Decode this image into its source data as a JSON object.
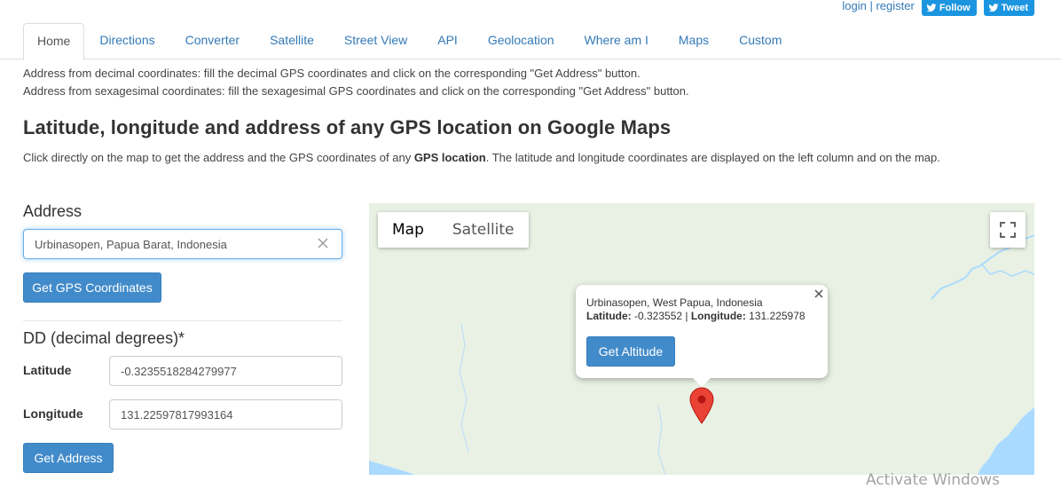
{
  "topbar": {
    "login": "login",
    "separator": "|",
    "register": "register",
    "follow": "Follow",
    "tweet": "Tweet"
  },
  "tabs": [
    {
      "label": "Home",
      "active": true
    },
    {
      "label": "Directions"
    },
    {
      "label": "Converter"
    },
    {
      "label": "Satellite"
    },
    {
      "label": "Street View"
    },
    {
      "label": "API"
    },
    {
      "label": "Geolocation"
    },
    {
      "label": "Where am I"
    },
    {
      "label": "Maps"
    },
    {
      "label": "Custom"
    }
  ],
  "intro": {
    "line1": "Address from decimal coordinates: fill the decimal GPS coordinates and click on the corresponding \"Get Address\" button.",
    "line2": "Address from sexagesimal coordinates: fill the sexagesimal GPS coordinates and click on the corresponding \"Get Address\" button."
  },
  "page": {
    "title": "Latitude, longitude and address of any GPS location on Google Maps",
    "desc_before": "Click directly on the map to get the address and the GPS coordinates of any ",
    "desc_bold": "GPS location",
    "desc_after": ". The latitude and longitude coordinates are displayed on the left column and on the map."
  },
  "address": {
    "heading": "Address",
    "value": "Urbinasopen, Papua Barat, Indonesia",
    "button": "Get GPS Coordinates"
  },
  "dd": {
    "heading": "DD (decimal degrees)*",
    "lat_label": "Latitude",
    "lat_value": "-0.3235518284279977",
    "lng_label": "Longitude",
    "lng_value": "131.22597817993164",
    "button": "Get Address"
  },
  "map": {
    "type_map": "Map",
    "type_satellite": "Satellite",
    "info": {
      "address": "Urbinasopen, West Papua, Indonesia",
      "lat_label": "Latitude:",
      "lat_value": " -0.323552 ",
      "sep": "| ",
      "lng_label": "Longitude:",
      "lng_value": " 131.225978",
      "button": "Get Altitude"
    },
    "colors": {
      "land": "#e8f1e4",
      "water": "#aadaff",
      "marker": "#ea4335"
    }
  },
  "watermark": "Activate Windows"
}
